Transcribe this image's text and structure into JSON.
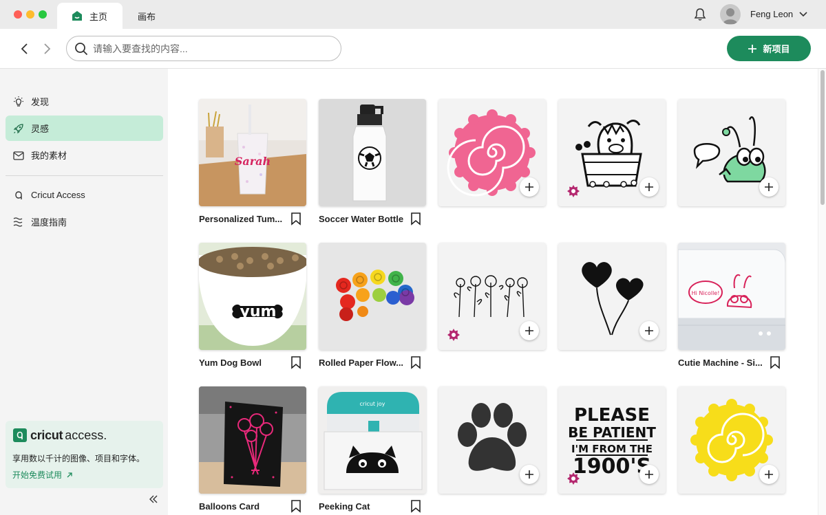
{
  "window": {
    "tabs": [
      {
        "label": "主页",
        "active": true
      },
      {
        "label": "画布",
        "active": false
      }
    ],
    "user_name": "Feng Leon"
  },
  "toolbar": {
    "search_placeholder": "请输入要查找的内容...",
    "new_project_label": "新项目"
  },
  "sidebar": {
    "items": [
      {
        "label": "发现",
        "icon": "lightbulb-icon",
        "active": false
      },
      {
        "label": "灵感",
        "icon": "rocket-icon",
        "active": true
      },
      {
        "label": "我的素材",
        "icon": "inbox-icon",
        "active": false
      },
      {
        "label": "Cricut Access",
        "icon": "access-icon",
        "active": false
      },
      {
        "label": "温度指南",
        "icon": "heat-icon",
        "active": false
      }
    ],
    "promo": {
      "brand": "cricut",
      "brand_suffix": "access.",
      "text": "享用数以千计的图像、项目和字体。",
      "link": "开始免费试用"
    }
  },
  "grid": {
    "rows": [
      [
        {
          "caption": "Personalized Tum...",
          "type": "project",
          "art": "tumbler"
        },
        {
          "caption": "Soccer Water Bottle",
          "type": "project",
          "art": "bottle"
        },
        {
          "caption": "",
          "type": "image",
          "art": "pink-rose",
          "access": false
        },
        {
          "caption": "",
          "type": "image",
          "art": "highland-cow",
          "access": true
        },
        {
          "caption": "",
          "type": "image",
          "art": "bug",
          "access": false
        }
      ],
      [
        {
          "caption": "Yum Dog Bowl",
          "type": "project",
          "art": "dog-bowl"
        },
        {
          "caption": "Rolled Paper Flow...",
          "type": "project",
          "art": "paper-flowers"
        },
        {
          "caption": "",
          "type": "image",
          "art": "wildflowers",
          "access": true
        },
        {
          "caption": "",
          "type": "image",
          "art": "balloons",
          "access": false
        },
        {
          "caption": "Cutie Machine - Si...",
          "type": "project",
          "art": "machine"
        }
      ],
      [
        {
          "caption": "Balloons Card",
          "type": "project",
          "art": "card"
        },
        {
          "caption": "Peeking Cat",
          "type": "project",
          "art": "cricut-joy"
        },
        {
          "caption": "",
          "type": "image",
          "art": "paw",
          "access": false
        },
        {
          "caption": "",
          "type": "image",
          "art": "please-patient",
          "access": true
        },
        {
          "caption": "",
          "type": "image",
          "art": "yellow-rose",
          "access": false
        }
      ]
    ],
    "texts": {
      "sarah": "Sarah",
      "yum": "yum",
      "hi_nicolle": "Hi Nicolle!",
      "cricut_joy": "cricut joy",
      "please_patient": [
        "PLEASE",
        "BE PATIENT",
        "I'M FROM THE",
        "1900'S"
      ]
    }
  },
  "colors": {
    "accent": "#1d8b5c",
    "active_nav": "#c5ecd8",
    "access_badge": "#b4286f",
    "rose_pink": "#f06592",
    "rose_yellow": "#f7dd1a",
    "bug_green": "#7ed8a0"
  }
}
